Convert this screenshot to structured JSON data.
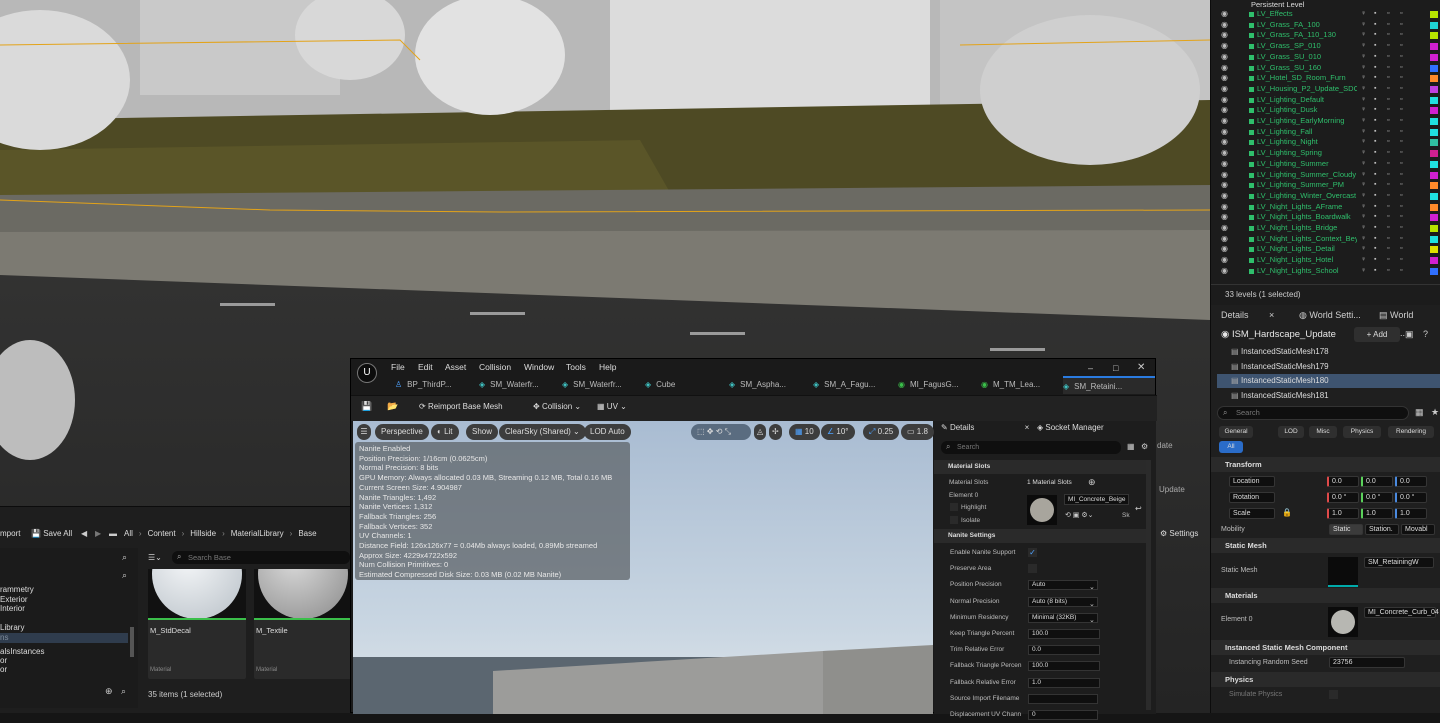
{
  "outliner": {
    "persistent_level": "Persistent Level",
    "levels": [
      "LV_Effects",
      "LV_Grass_FA_100",
      "LV_Grass_FA_110_130",
      "LV_Grass_SP_010",
      "LV_Grass_SU_010",
      "LV_Grass_SU_160",
      "LV_Hotel_SD_Room_Furn",
      "LV_Housing_P2_Update_SDCa",
      "LV_Lighting_Default",
      "LV_Lighting_Dusk",
      "LV_Lighting_EarlyMorning",
      "LV_Lighting_Fall",
      "LV_Lighting_Night",
      "LV_Lighting_Spring",
      "LV_Lighting_Summer",
      "LV_Lighting_Summer_Cloudy",
      "LV_Lighting_Summer_PM",
      "LV_Lighting_Winter_Overcast",
      "LV_Night_Lights_AFrame",
      "LV_Night_Lights_Boardwalk",
      "LV_Night_Lights_Bridge",
      "LV_Night_Lights_Context_Beyc",
      "LV_Night_Lights_Detail",
      "LV_Night_Lights_Hotel",
      "LV_Night_Lights_School"
    ],
    "swatches": [
      "#b7e300",
      "#1fd3d3",
      "#b7e300",
      "#d020d0",
      "#d020d0",
      "#3070ff",
      "#ff8a2a",
      "#c040e0",
      "#20e0e0",
      "#d020d0",
      "#20e0e0",
      "#20e0e0",
      "#30c0a0",
      "#d02090",
      "#20e0e0",
      "#d020d0",
      "#ff8a2a",
      "#20e0e0",
      "#ff8a2a",
      "#d020d0",
      "#b7e300",
      "#20e0e0",
      "#e0e000",
      "#d020d0",
      "#3070ff"
    ],
    "status": "33 levels (1 selected)"
  },
  "right_details": {
    "tabs": [
      "Details",
      "World Setti...",
      "World Parti..."
    ],
    "actor": "ISM_Hardscape_Update",
    "add": "+ Add",
    "components": [
      "InstancedStaticMesh178",
      "InstancedStaticMesh179",
      "InstancedStaticMesh180",
      "InstancedStaticMesh181"
    ],
    "search_placeholder": "Search",
    "filters": [
      "General",
      "LOD",
      "Misc",
      "Physics",
      "Rendering",
      "All"
    ],
    "transform": "Transform",
    "location": "Location",
    "rotation": "Rotation",
    "scale": "Scale",
    "loc": [
      "0.0",
      "0.0",
      "0.0"
    ],
    "rot": [
      "0.0 °",
      "0.0 °",
      "0.0 °"
    ],
    "scl": [
      "1.0",
      "1.0",
      "1.0"
    ],
    "mobility": "Mobility",
    "mob": [
      "Static",
      "Station.",
      "Movabl"
    ],
    "static_mesh_h": "Static Mesh",
    "static_mesh_l": "Static Mesh",
    "static_mesh_v": "SM_RetainingW",
    "materials_h": "Materials",
    "element0": "Element 0",
    "mat_v": "MI_Concrete_Curb_04",
    "ism_h": "Instanced Static Mesh Component",
    "seed_l": "Instancing Random Seed",
    "seed_v": "23756",
    "physics_h": "Physics",
    "sim_l": "Simulate Physics",
    "date": "date",
    "update": "Update"
  },
  "content_browser": {
    "import": "mport",
    "save_all": "Save All",
    "crumbs": [
      "All",
      "Content",
      "Hillside",
      "MaterialLibrary",
      "Base"
    ],
    "search_placeholder": "Search Base",
    "tree": [
      "rammetry",
      "Exterior",
      "Interior",
      "Library",
      "ns",
      "alsInstances",
      "or",
      "or"
    ],
    "assets": [
      {
        "name": "M_StdDecal",
        "type": "Material"
      },
      {
        "name": "M_Textile",
        "type": "Material"
      }
    ],
    "count": "35 items (1 selected)",
    "settings": "Settings"
  },
  "editor": {
    "menus": [
      "File",
      "Edit",
      "Asset",
      "Collision",
      "Window",
      "Tools",
      "Help"
    ],
    "tabs": [
      "BP_ThirdP...",
      "SM_Waterfr...",
      "SM_Waterfr...",
      "Cube",
      "SM_Aspha...",
      "SM_A_Fagu...",
      "MI_FagusG...",
      "M_TM_Lea...",
      "SM_Retaini..."
    ],
    "reimport": "Reimport Base Mesh",
    "collision": "Collision",
    "uv": "UV",
    "perspective": "Perspective",
    "lit": "Lit",
    "show": "Show",
    "clearsky": "ClearSky (Shared)",
    "lod": "LOD Auto",
    "grid": "10",
    "angle": "10°",
    "scale": "0.25",
    "cam": "1.8",
    "stats": [
      "Nanite Enabled",
      "Position Precision: 1/16cm (0.0625cm)",
      "Normal Precision: 8 bits",
      "GPU Memory: Always allocated 0.03 MB, Streaming 0.12 MB, Total 0.16 MB",
      "Current Screen Size: 4.904987",
      "Nanite Triangles:  1,492",
      "Nanite Vertices:  1,312",
      "Fallback Triangles:  256",
      "Fallback Vertices:  352",
      "UV Channels:  1",
      "Distance Field: 126x126x77 = 0.04Mb always loaded, 0.89Mb streamed",
      "Approx Size: 4229x4722x592",
      "Num Collision Primitives:  0",
      "Estimated Compressed Disk Size: 0.03 MB (0.02 MB Nanite)"
    ],
    "details_tab": "Details",
    "socket_tab": "Socket Manager",
    "search_placeholder": "Search",
    "sec_material": "Material Slots",
    "mat_slots_l": "Material Slots",
    "mat_slots_v": "1 Material Slots",
    "element0": "Element 0",
    "mat_v": "MI_Concrete_Beige",
    "highlight": "Highlight",
    "isolate": "Isolate",
    "sk": "Sk",
    "sec_nanite": "Nanite Settings",
    "rows": [
      {
        "k": "Enable Nanite Support",
        "v": "✓"
      },
      {
        "k": "Preserve Area",
        "v": ""
      },
      {
        "k": "Position Precision",
        "v": "Auto"
      },
      {
        "k": "Normal Precision",
        "v": "Auto (8 bits)"
      },
      {
        "k": "Minimum Residency",
        "v": "Minimal (32KB)"
      },
      {
        "k": "Keep Triangle Percent",
        "v": "100.0"
      },
      {
        "k": "Trim Relative Error",
        "v": "0.0"
      },
      {
        "k": "Fallback Triangle Percen",
        "v": "100.0"
      },
      {
        "k": "Fallback Relative Error",
        "v": "1.0"
      },
      {
        "k": "Source Import Filename",
        "v": ""
      },
      {
        "k": "Displacement UV Chann",
        "v": "0"
      }
    ]
  }
}
